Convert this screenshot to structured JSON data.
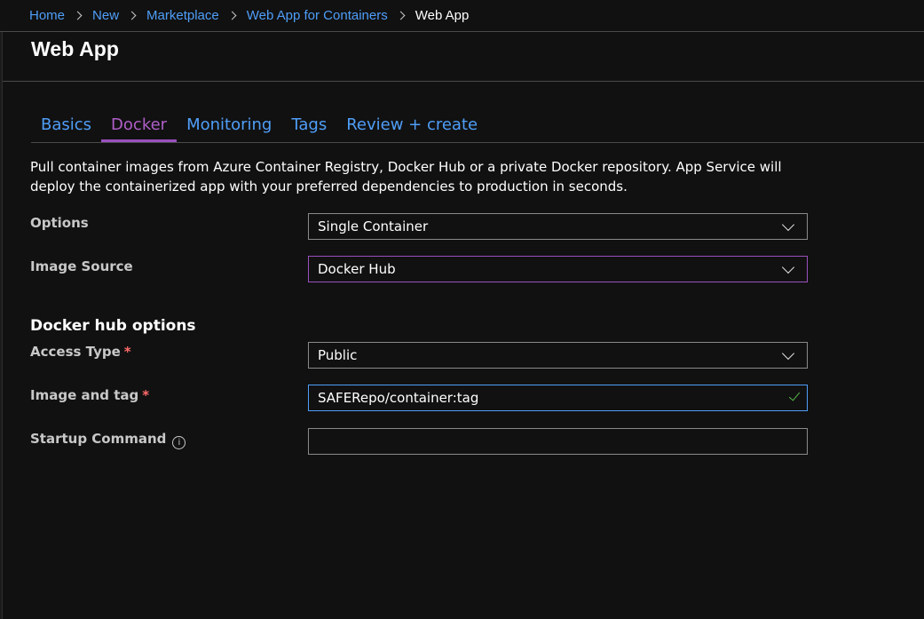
{
  "breadcrumb": {
    "items": [
      "Home",
      "New",
      "Marketplace",
      "Web App for Containers"
    ],
    "current": "Web App"
  },
  "page": {
    "title": "Web App"
  },
  "tabs": [
    {
      "label": "Basics",
      "active": false
    },
    {
      "label": "Docker",
      "active": true
    },
    {
      "label": "Monitoring",
      "active": false
    },
    {
      "label": "Tags",
      "active": false
    },
    {
      "label": "Review + create",
      "active": false
    }
  ],
  "description": "Pull container images from Azure Container Registry, Docker Hub or a private Docker repository. App Service will deploy the containerized app with your preferred dependencies to production in seconds.",
  "form": {
    "options": {
      "label": "Options",
      "value": "Single Container"
    },
    "image_source": {
      "label": "Image Source",
      "value": "Docker Hub"
    },
    "section_heading": "Docker hub options",
    "access_type": {
      "label": "Access Type",
      "required_mark": "*",
      "value": "Public"
    },
    "image_and_tag": {
      "label": "Image and tag",
      "required_mark": "*",
      "value": "SAFERepo/container:tag"
    },
    "startup_command": {
      "label": "Startup Command",
      "info_glyph": "i",
      "value": ""
    }
  },
  "colors": {
    "link": "#4f9ef8",
    "active_tab": "#b05fc9",
    "required": "#ff6b6b",
    "valid_check": "#59b84c"
  }
}
